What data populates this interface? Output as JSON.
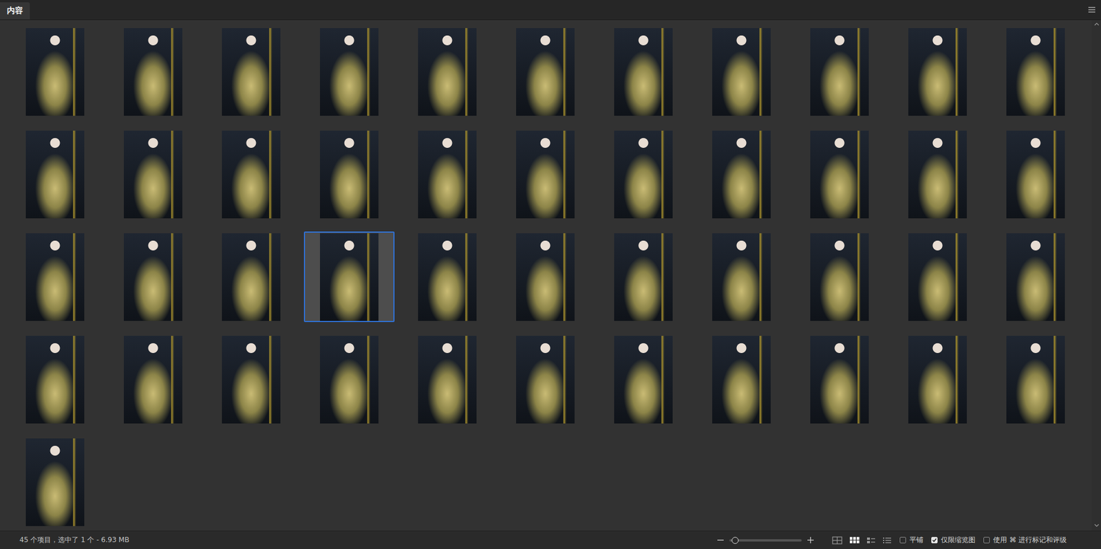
{
  "panel": {
    "tab": "内容"
  },
  "thumbnails": [
    {
      "selected": false
    },
    {
      "selected": false
    },
    {
      "selected": false
    },
    {
      "selected": false
    },
    {
      "selected": false
    },
    {
      "selected": false
    },
    {
      "selected": false
    },
    {
      "selected": false
    },
    {
      "selected": false
    },
    {
      "selected": false
    },
    {
      "selected": false
    },
    {
      "selected": false
    },
    {
      "selected": false
    },
    {
      "selected": false
    },
    {
      "selected": false
    },
    {
      "selected": false
    },
    {
      "selected": false
    },
    {
      "selected": false
    },
    {
      "selected": false
    },
    {
      "selected": false
    },
    {
      "selected": false
    },
    {
      "selected": false
    },
    {
      "selected": false
    },
    {
      "selected": false
    },
    {
      "selected": false
    },
    {
      "selected": true
    },
    {
      "selected": false
    },
    {
      "selected": false
    },
    {
      "selected": false
    },
    {
      "selected": false
    },
    {
      "selected": false
    },
    {
      "selected": false
    },
    {
      "selected": false
    },
    {
      "selected": false
    },
    {
      "selected": false
    },
    {
      "selected": false
    },
    {
      "selected": false
    },
    {
      "selected": false
    },
    {
      "selected": false
    },
    {
      "selected": false
    },
    {
      "selected": false
    },
    {
      "selected": false
    },
    {
      "selected": false
    },
    {
      "selected": false
    },
    {
      "selected": false
    }
  ],
  "status_bar": {
    "summary": "45 个项目，选中了 1 个 - 6.93 MB",
    "zoom": {
      "level": 0.08
    },
    "view_modes": [
      {
        "kind": "grid-large",
        "selected": false
      },
      {
        "kind": "grid",
        "selected": true
      },
      {
        "kind": "detail",
        "selected": false
      },
      {
        "kind": "list",
        "selected": false
      }
    ],
    "options": [
      {
        "label": "平铺",
        "checked": false
      },
      {
        "label": "仅限缩览图",
        "checked": true
      },
      {
        "label": "使用 ⌘ 进行标记和评级",
        "checked": false
      }
    ]
  }
}
